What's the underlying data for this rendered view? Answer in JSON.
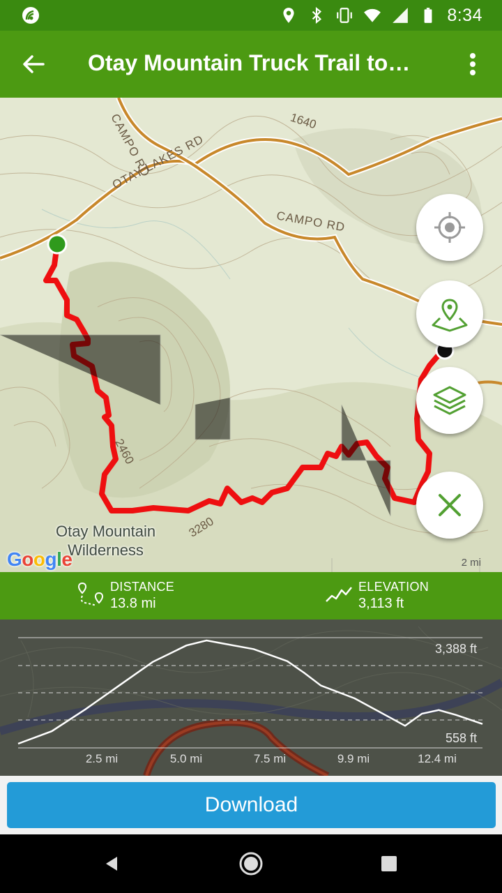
{
  "status_bar": {
    "time": "8:34",
    "icons": [
      "wireless-sync-icon",
      "location-icon",
      "bluetooth-icon",
      "vibrate-icon",
      "wifi-icon",
      "cell-signal-icon",
      "battery-icon"
    ]
  },
  "app_bar": {
    "title": "Otay Mountain Truck Trail to…",
    "back_icon": "arrow-back-icon",
    "menu_icon": "more-vert-icon"
  },
  "map": {
    "road_labels": [
      "CAMPO RD",
      "OTAY LAKES RD",
      "CAMPO RD"
    ],
    "contour_labels": [
      "1640",
      "2460",
      "3280"
    ],
    "area_label_line1": "Otay Mountain",
    "area_label_line2": "Wilderness",
    "attribution": "Google",
    "scale_label": "2 mi",
    "colors": {
      "route": "#ee0f10",
      "road": "#c8882b",
      "start": "#2f9a1c",
      "end": "#111111",
      "fab_accent": "#52a032"
    },
    "controls": [
      "my-location-icon",
      "map-pin-icon",
      "layers-icon",
      "close-icon"
    ]
  },
  "stats": {
    "distance_label": "DISTANCE",
    "distance_value": "13.8 mi",
    "elevation_label": "ELEVATION",
    "elevation_value": "3,113 ft"
  },
  "elevation_profile": {
    "max_label": "3,388 ft",
    "min_label": "558 ft",
    "x_ticks": [
      "2.5 mi",
      "5.0 mi",
      "7.5 mi",
      "9.9 mi",
      "12.4 mi"
    ]
  },
  "chart_data": {
    "type": "area",
    "x": [
      0,
      1,
      2,
      3,
      4,
      5,
      5.6,
      6,
      7,
      8,
      8.5,
      9,
      10,
      11,
      11.5,
      12,
      12.5,
      13,
      13.8
    ],
    "y": [
      558,
      900,
      1500,
      2150,
      2800,
      3250,
      3388,
      3320,
      3150,
      2820,
      2500,
      2150,
      1800,
      1300,
      1050,
      1380,
      1480,
      1350,
      1100
    ],
    "xlabel": "",
    "ylabel": "",
    "x_ticks": [
      "2.5 mi",
      "5.0 mi",
      "7.5 mi",
      "9.9 mi",
      "12.4 mi"
    ],
    "ylim": [
      558,
      3388
    ],
    "xlim": [
      0,
      13.8
    ]
  },
  "actions": {
    "download_label": "Download"
  },
  "nav_bar": {
    "back": "nav-back-icon",
    "home": "nav-home-icon",
    "recents": "nav-recents-icon"
  }
}
